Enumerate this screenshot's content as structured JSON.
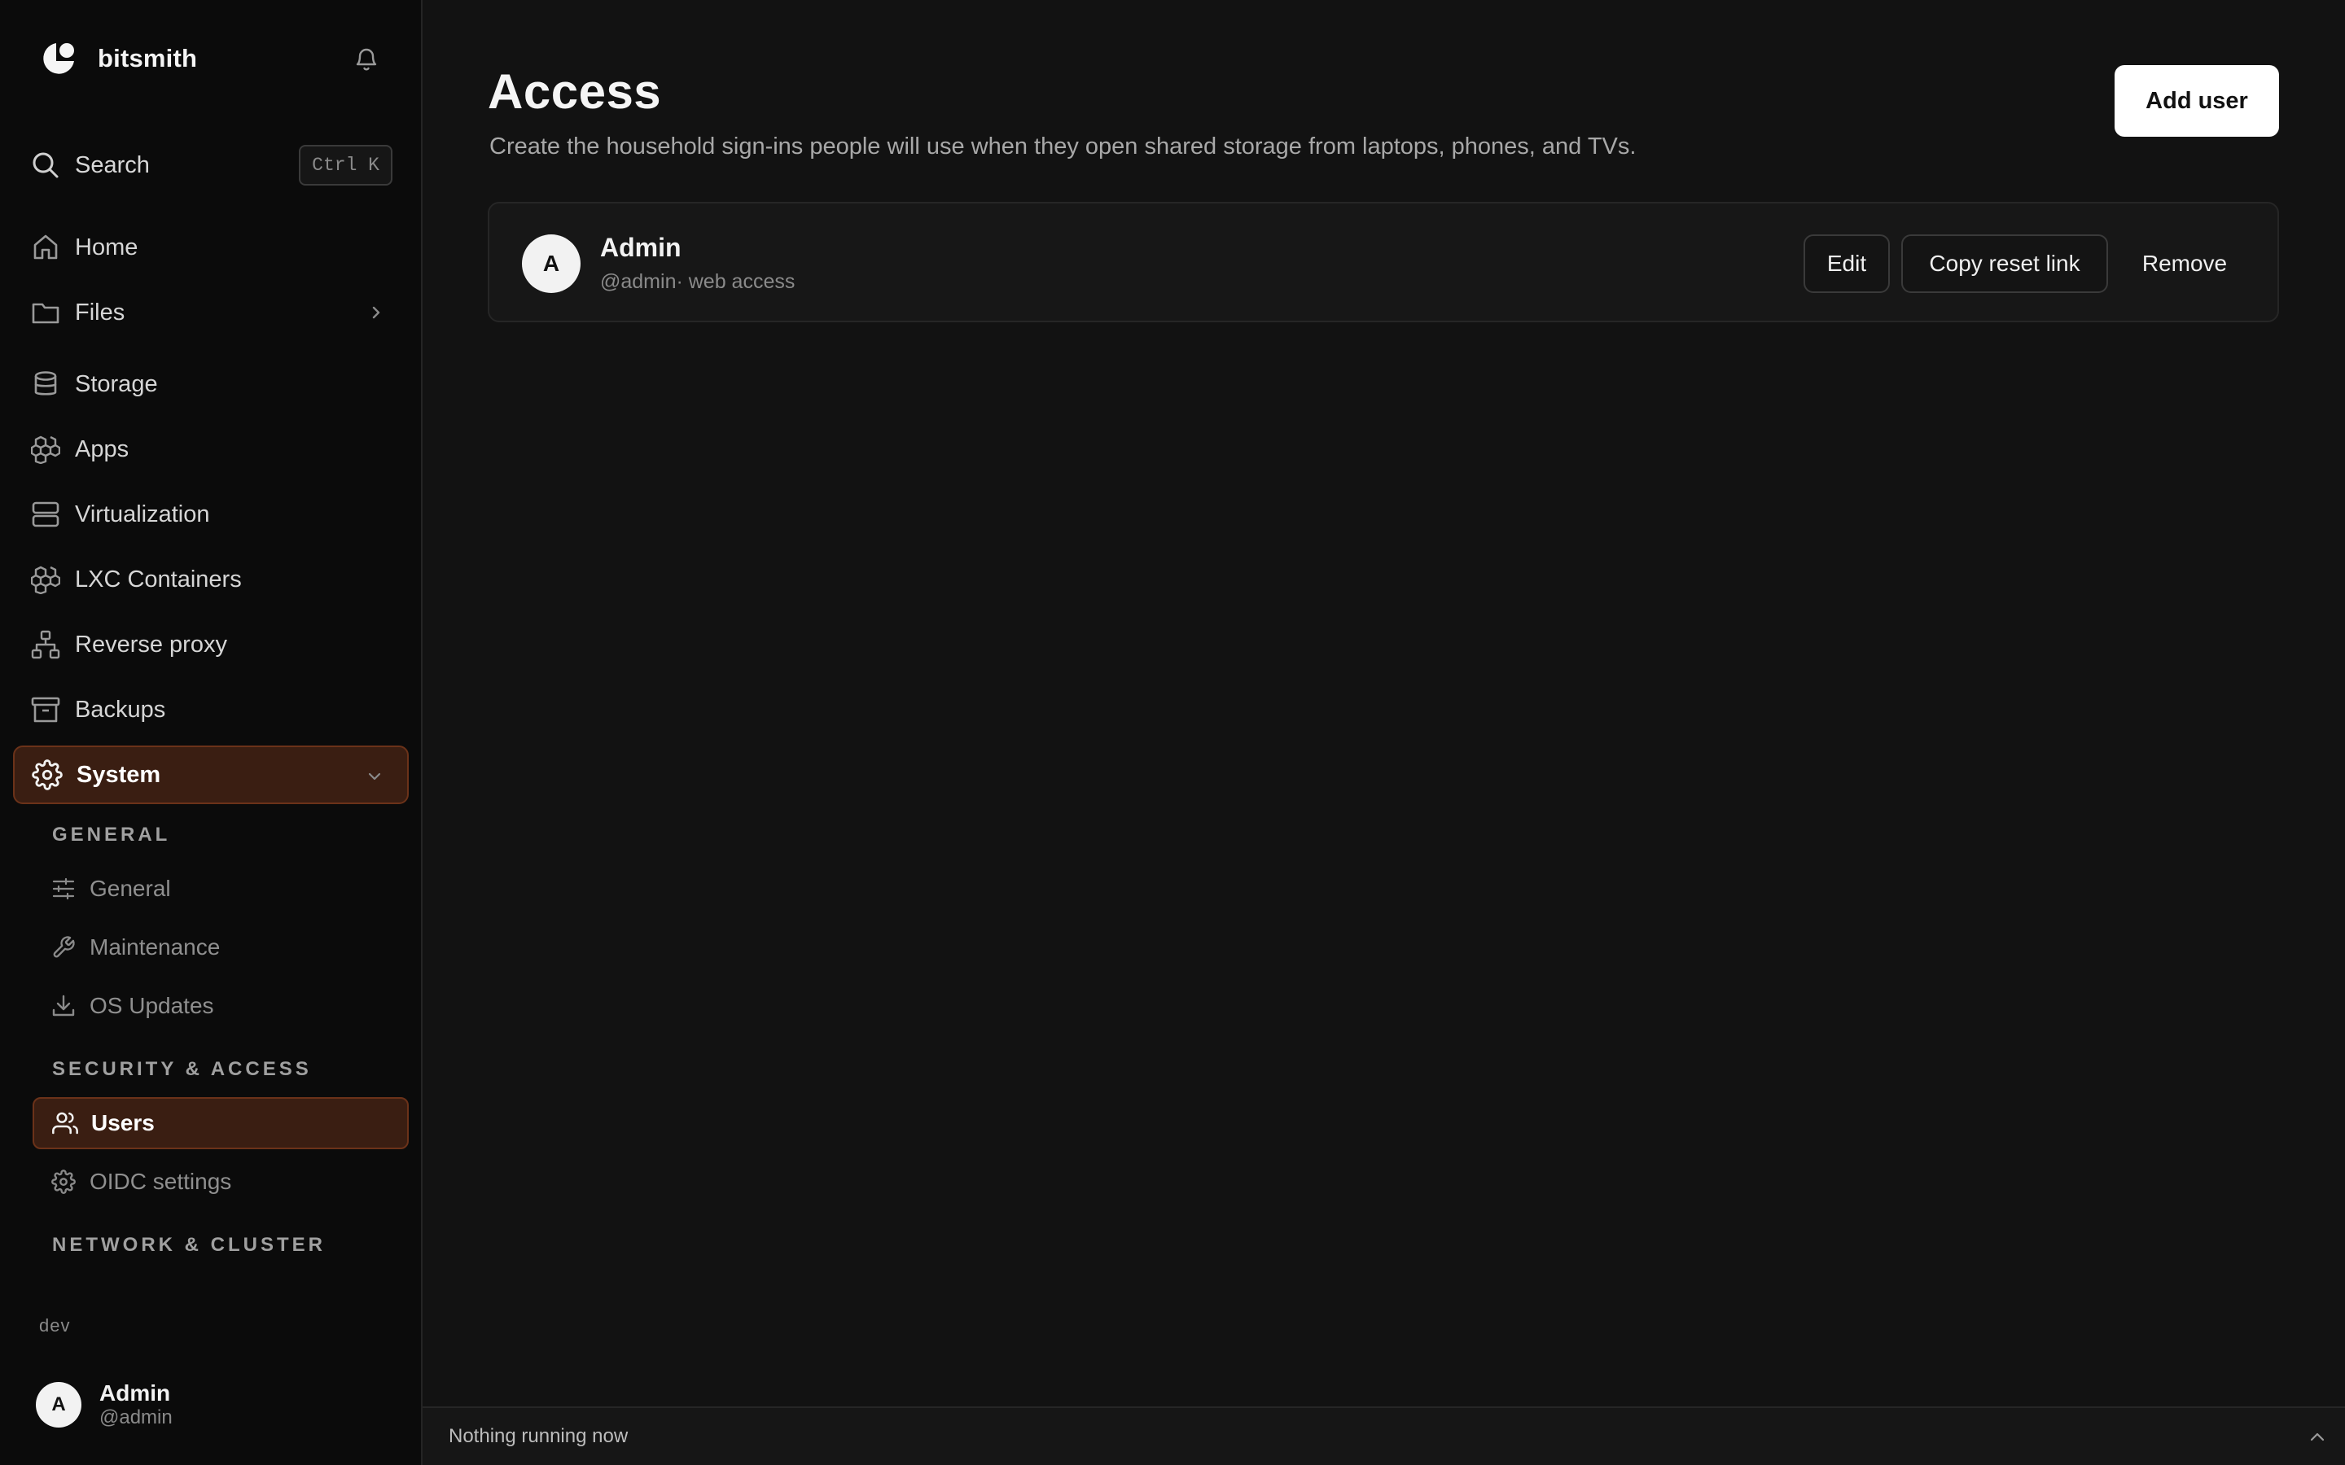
{
  "brand": {
    "name": "bitsmith",
    "logo_icon": "bitsmith-logo-icon"
  },
  "colors": {
    "accent_bg": "#3a1e12",
    "accent_border": "#6b3219",
    "background": "#121212",
    "sidebar_bg": "#0b0b0b"
  },
  "search": {
    "label": "Search",
    "shortcut": "Ctrl K"
  },
  "sidebar": {
    "nav": [
      {
        "label": "Home",
        "icon": "home-icon"
      },
      {
        "label": "Files",
        "icon": "folder-icon",
        "chevron": "chevron-right-icon"
      },
      {
        "label": "Storage",
        "icon": "database-icon"
      },
      {
        "label": "Apps",
        "icon": "boxes-icon"
      },
      {
        "label": "Virtualization",
        "icon": "server-icon"
      },
      {
        "label": "LXC Containers",
        "icon": "boxes-icon"
      },
      {
        "label": "Reverse proxy",
        "icon": "network-icon"
      },
      {
        "label": "Backups",
        "icon": "archive-icon"
      },
      {
        "label": "System",
        "icon": "gear-icon",
        "chevron": "chevron-down-icon",
        "active": true
      }
    ],
    "sections": [
      {
        "title": "GENERAL",
        "items": [
          {
            "label": "General",
            "icon": "sliders-icon"
          },
          {
            "label": "Maintenance",
            "icon": "wrench-icon"
          },
          {
            "label": "OS Updates",
            "icon": "download-icon"
          }
        ]
      },
      {
        "title": "SECURITY & ACCESS",
        "items": [
          {
            "label": "Users",
            "icon": "users-icon",
            "active": true
          },
          {
            "label": "OIDC settings",
            "icon": "gear-icon"
          }
        ]
      },
      {
        "title": "NETWORK & CLUSTER",
        "items": []
      }
    ],
    "env": "dev",
    "current_user": {
      "initial": "A",
      "name": "Admin",
      "handle": "@admin"
    }
  },
  "main": {
    "title": "Access",
    "subtitle": "Create the household sign-ins people will use when they open shared storage from laptops, phones, and TVs.",
    "add_button": "Add user",
    "users": [
      {
        "initial": "A",
        "name": "Admin",
        "meta": "@admin· web access",
        "actions": {
          "edit": "Edit",
          "copy_reset": "Copy reset link",
          "remove": "Remove"
        }
      }
    ]
  },
  "status_bar": {
    "text": "Nothing running now",
    "toggle_icon": "chevron-up-icon"
  }
}
